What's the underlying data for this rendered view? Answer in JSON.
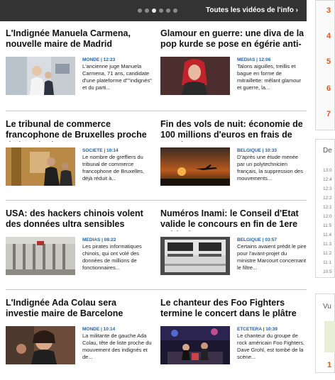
{
  "topbar": {
    "videos_link": "Toutes les vidéos de l'info ›",
    "carousel_dots": 6,
    "active_dot": 2
  },
  "articles": [
    {
      "headline": "L'Indignée Manuela Carmena, nouvelle maire de Madrid",
      "meta": "MONDE | 12:23",
      "summary": "L'ancienne juge Manuela Carmena, 71 ans, candidate d'une plateforme d\"\"indignés\" et du parti..."
    },
    {
      "headline": "Glamour en guerre: une diva de la pop kurde se pose en égérie anti-EI",
      "meta": "MEDIAS | 12:06",
      "summary": "Talons aiguilles, treillis et bague en forme de mitraillette: mêlant glamour et guerre, la..."
    },
    {
      "headline": "Le tribunal de commerce francophone de Bruxelles proche de l'explosion",
      "meta": "SOCIETE | 10:14",
      "summary": "Le nombre de greffiers du tribunal de commerce francophone de Bruxelles, déjà réduit à..."
    },
    {
      "headline": "Fin des vols de nuit: économie de 100 millions d'euros en frais de santé",
      "meta": "BELGIQUE | 10:33",
      "summary": "D'après une étude menée par un polytechnicien français, la suppression des mouvements..."
    },
    {
      "headline": "USA: des hackers chinois volent des données ultra sensibles",
      "meta": "MEDIAS | 08:22",
      "summary": "Les pirates informatiques chinois, qui ont volé des données de millions de fonctionnaires..."
    },
    {
      "headline": "Numéros Inami: le Conseil d'Etat valide le concours en fin de 1ere médecine",
      "meta": "BELGIQUE | 03:57",
      "summary": "Certains avaient prédit le pire pour l'avant-projet du ministre Marcourt concernant le filtre..."
    },
    {
      "headline": "L'Indignée Ada Colau sera investie maire de Barcelone",
      "meta": "MONDE | 10:14",
      "summary": "La militante de gauche Ada Colau, tête de liste proche du mouvement des indignés et de..."
    },
    {
      "headline": "Le chanteur des Foo Fighters termine le concert dans le plâtre",
      "meta": "ETCETERA | 10:39",
      "summary": "Le chanteur du groupe de rock américain Foo Fighters, Dave Grohl, est tombé de la scène..."
    }
  ],
  "sidebar": {
    "ranks": [
      "3",
      "4",
      "5",
      "6",
      "7"
    ],
    "dernier_title": "De",
    "times": [
      "13:0",
      "12:4",
      "12:3",
      "12:2",
      "12:1",
      "12:0",
      "11:5",
      "11:4",
      "11:3",
      "11:2",
      "11:1",
      "10:5"
    ],
    "vu_title": "Vu",
    "vu_first": "1"
  },
  "colors": {
    "topbar": "#333333",
    "meta_blue": "#1f5fa8",
    "rank_orange": "#e0561c"
  }
}
